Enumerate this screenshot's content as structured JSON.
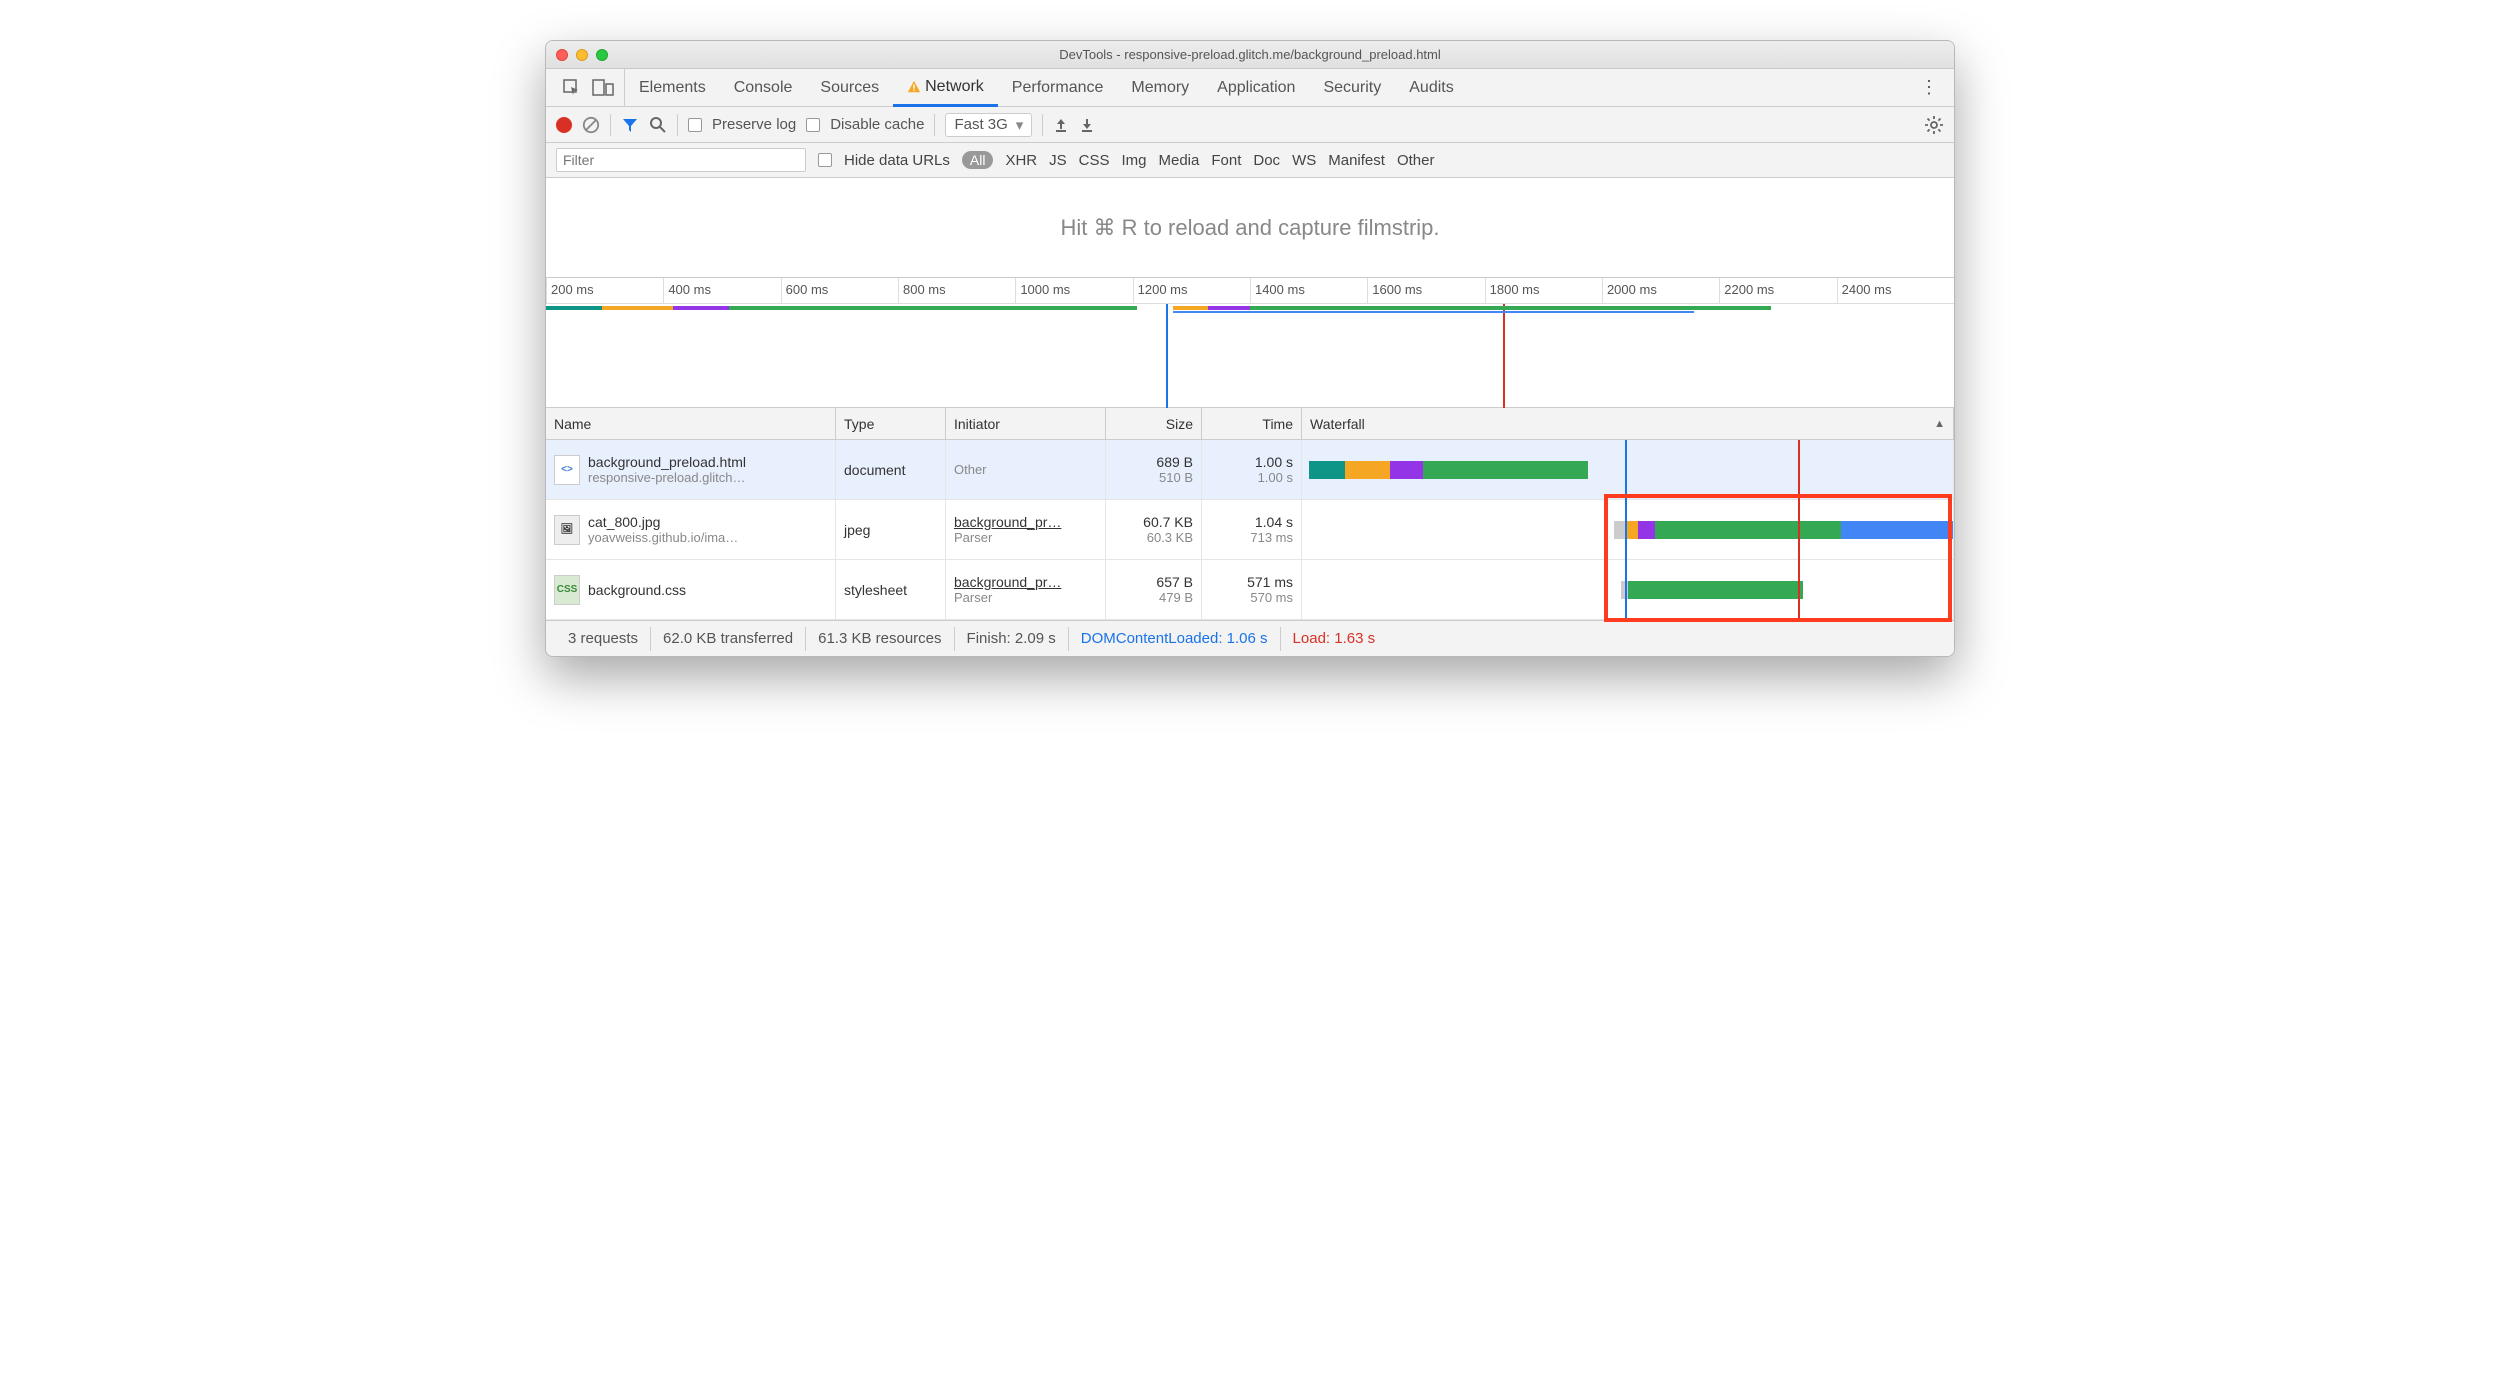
{
  "window_title": "DevTools - responsive-preload.glitch.me/background_preload.html",
  "tabs": {
    "elements": "Elements",
    "console": "Console",
    "sources": "Sources",
    "network": "Network",
    "performance": "Performance",
    "memory": "Memory",
    "application": "Application",
    "security": "Security",
    "audits": "Audits"
  },
  "toolbar": {
    "preserve_log": "Preserve log",
    "disable_cache": "Disable cache",
    "throttle": "Fast 3G"
  },
  "filter": {
    "placeholder": "Filter",
    "hide_data_urls": "Hide data URLs",
    "all": "All",
    "types": [
      "XHR",
      "JS",
      "CSS",
      "Img",
      "Media",
      "Font",
      "Doc",
      "WS",
      "Manifest",
      "Other"
    ]
  },
  "filmstrip_hint": "Hit ⌘ R to reload and capture filmstrip.",
  "ruler_ticks": [
    "200 ms",
    "400 ms",
    "600 ms",
    "800 ms",
    "1000 ms",
    "1200 ms",
    "1400 ms",
    "1600 ms",
    "1800 ms",
    "2000 ms",
    "2200 ms",
    "2400 ms"
  ],
  "columns": {
    "name": "Name",
    "type": "Type",
    "initiator": "Initiator",
    "size": "Size",
    "time": "Time",
    "waterfall": "Waterfall"
  },
  "requests": [
    {
      "name": "background_preload.html",
      "sub": "responsive-preload.glitch…",
      "type": "document",
      "initiator": "Other",
      "initiator_sub": "",
      "size": "689 B",
      "size_sub": "510 B",
      "time": "1.00 s",
      "time_sub": "1.00 s",
      "icon": "html"
    },
    {
      "name": "cat_800.jpg",
      "sub": "yoavweiss.github.io/ima…",
      "type": "jpeg",
      "initiator": "background_pr…",
      "initiator_sub": "Parser",
      "size": "60.7 KB",
      "size_sub": "60.3 KB",
      "time": "1.04 s",
      "time_sub": "713 ms",
      "icon": "img"
    },
    {
      "name": "background.css",
      "sub": "",
      "type": "stylesheet",
      "initiator": "background_pr…",
      "initiator_sub": "Parser",
      "size": "657 B",
      "size_sub": "479 B",
      "time": "571 ms",
      "time_sub": "570 ms",
      "icon": "css"
    }
  ],
  "status": {
    "requests": "3 requests",
    "transferred": "62.0 KB transferred",
    "resources": "61.3 KB resources",
    "finish": "Finish: 2.09 s",
    "dcl": "DOMContentLoaded: 1.06 s",
    "load": "Load: 1.63 s"
  }
}
